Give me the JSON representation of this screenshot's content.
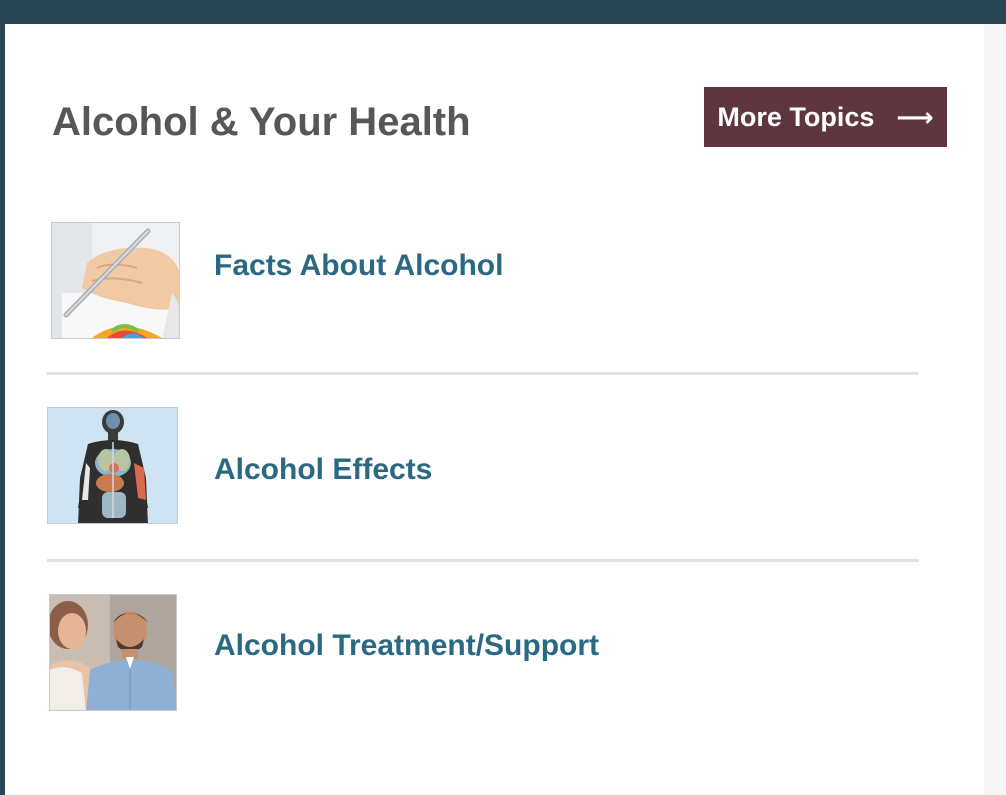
{
  "section": {
    "title": "Alcohol & Your Health",
    "more_button_label": "More Topics",
    "more_button_icon": "arrow-right-icon"
  },
  "topics": [
    {
      "label": "Facts About Alcohol",
      "thumbnail": "hand-writing-chart-image"
    },
    {
      "label": "Alcohol Effects",
      "thumbnail": "human-body-organs-image"
    },
    {
      "label": "Alcohol Treatment/Support",
      "thumbnail": "people-talking-image"
    }
  ],
  "colors": {
    "top_bar": "#294652",
    "button_bg": "#5f363f",
    "heading": "#575757",
    "link": "#2b6983",
    "divider": "#e2e2e2"
  }
}
